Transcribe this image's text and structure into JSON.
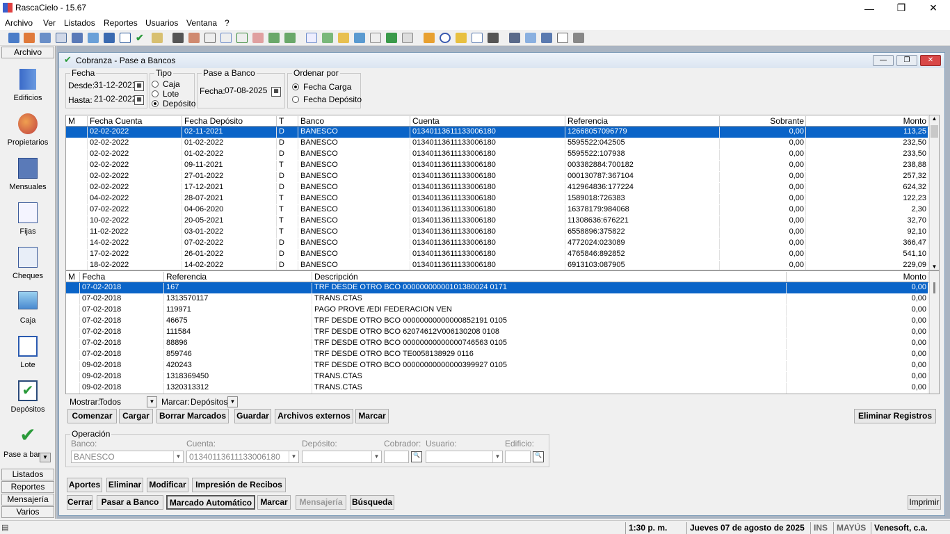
{
  "app": {
    "title": "RascaCielo - 15.67",
    "menu": [
      "Archivo",
      "Ver",
      "Listados",
      "Reportes",
      "Usuarios",
      "Ventana",
      "?"
    ]
  },
  "sidebar": {
    "header": "Archivo",
    "items": [
      "Edificios",
      "Propietarios",
      "Mensuales",
      "Fijas",
      "Cheques",
      "Caja",
      "Lote",
      "Depósitos",
      "Pase a bar"
    ],
    "bottom": [
      "Listados",
      "Reportes",
      "Mensajería",
      "Varios"
    ]
  },
  "window": {
    "title": "Cobranza - Pase a Bancos"
  },
  "fecha": {
    "legend": "Fecha",
    "desde_label": "Desde:",
    "desde": "31-12-2021",
    "hasta_label": "Hasta:",
    "hasta": "21-02-2022"
  },
  "tipo": {
    "legend": "Tipo",
    "options": [
      "Caja",
      "Lote",
      "Depósito"
    ]
  },
  "pase": {
    "legend": "Pase a Banco",
    "label": "Fecha:",
    "value": "07-08-2025"
  },
  "orden": {
    "legend": "Ordenar por",
    "options": [
      "Fecha Carga",
      "Fecha Depósito"
    ]
  },
  "grid1": {
    "headers": [
      "M",
      "Fecha Cuenta",
      "Fecha Depósito",
      "T",
      "Banco",
      "Cuenta",
      "Referencia",
      "Sobrante",
      "Monto"
    ],
    "rows": [
      [
        "",
        "02-02-2022",
        "02-11-2021",
        "D",
        "BANESCO",
        "01340113611133006180",
        "12668057096779",
        "0,00",
        "113,25"
      ],
      [
        "",
        "02-02-2022",
        "01-02-2022",
        "D",
        "BANESCO",
        "01340113611133006180",
        "5595522:042505",
        "0,00",
        "232,50"
      ],
      [
        "",
        "02-02-2022",
        "01-02-2022",
        "D",
        "BANESCO",
        "01340113611133006180",
        "5595522:107938",
        "0,00",
        "233,50"
      ],
      [
        "",
        "02-02-2022",
        "09-11-2021",
        "T",
        "BANESCO",
        "01340113611133006180",
        "003382884:700182",
        "0,00",
        "238,88"
      ],
      [
        "",
        "02-02-2022",
        "27-01-2022",
        "D",
        "BANESCO",
        "01340113611133006180",
        "000130787:367104",
        "0,00",
        "257,32"
      ],
      [
        "",
        "02-02-2022",
        "17-12-2021",
        "D",
        "BANESCO",
        "01340113611133006180",
        "412964836:177224",
        "0,00",
        "624,32"
      ],
      [
        "",
        "04-02-2022",
        "28-07-2021",
        "T",
        "BANESCO",
        "01340113611133006180",
        "1589018:726383",
        "0,00",
        "122,23"
      ],
      [
        "",
        "07-02-2022",
        "04-06-2020",
        "T",
        "BANESCO",
        "01340113611133006180",
        "16378179:984068",
        "0,00",
        "2,30"
      ],
      [
        "",
        "10-02-2022",
        "20-05-2021",
        "T",
        "BANESCO",
        "01340113611133006180",
        "11308636:676221",
        "0,00",
        "32,70"
      ],
      [
        "",
        "11-02-2022",
        "03-01-2022",
        "T",
        "BANESCO",
        "01340113611133006180",
        "6558896:375822",
        "0,00",
        "92,10"
      ],
      [
        "",
        "14-02-2022",
        "07-02-2022",
        "D",
        "BANESCO",
        "01340113611133006180",
        "4772024:023089",
        "0,00",
        "366,47"
      ],
      [
        "",
        "17-02-2022",
        "26-01-2022",
        "D",
        "BANESCO",
        "01340113611133006180",
        "4765846:892852",
        "0,00",
        "541,10"
      ],
      [
        "",
        "18-02-2022",
        "14-02-2022",
        "D",
        "BANESCO",
        "01340113611133006180",
        "6913103:087905",
        "0,00",
        "229,09"
      ]
    ]
  },
  "grid2": {
    "headers": [
      "M",
      "Fecha",
      "Referencia",
      "Descripción",
      "Monto"
    ],
    "rows": [
      [
        "",
        "07-02-2018",
        "167",
        "TRF DESDE OTRO BCO 00000000000101380024 0171",
        "0,00"
      ],
      [
        "",
        "07-02-2018",
        "1313570117",
        "TRANS.CTAS",
        "0,00"
      ],
      [
        "",
        "07-02-2018",
        "119971",
        "PAGO PROVE /EDI FEDERACION VEN",
        "0,00"
      ],
      [
        "",
        "07-02-2018",
        "46675",
        "TRF DESDE OTRO BCO 00000000000000852191 0105",
        "0,00"
      ],
      [
        "",
        "07-02-2018",
        "111584",
        "TRF DESDE OTRO BCO 62074612V006130208 0108",
        "0,00"
      ],
      [
        "",
        "07-02-2018",
        "88896",
        "TRF DESDE OTRO BCO 00000000000000746563 0105",
        "0,00"
      ],
      [
        "",
        "07-02-2018",
        "859746",
        "TRF DESDE OTRO BCO TE0058138929 0116",
        "0,00"
      ],
      [
        "",
        "09-02-2018",
        "420243",
        "TRF DESDE OTRO BCO 00000000000000399927 0105",
        "0,00"
      ],
      [
        "",
        "09-02-2018",
        "1318369450",
        "TRANS.CTAS",
        "0,00"
      ],
      [
        "",
        "09-02-2018",
        "1320313312",
        "TRANS.CTAS",
        "0,00"
      ]
    ]
  },
  "filters": {
    "mostrar_label": "Mostrar:",
    "mostrar": "Todos",
    "marcar_label": "Marcar:",
    "marcar": "Depósitos"
  },
  "buttons1": [
    "Comenzar",
    "Cargar",
    "Borrar Marcados",
    "Guardar",
    "Archivos externos",
    "Marcar"
  ],
  "eliminar_registros": "Eliminar Registros",
  "operacion": {
    "legend": "Operación",
    "banco_label": "Banco:",
    "banco": "BANESCO",
    "cuenta_label": "Cuenta:",
    "cuenta": "01340113611133006180",
    "deposito_label": "Depósito:",
    "cobrador_label": "Cobrador:",
    "usuario_label": "Usuario:",
    "edificio_label": "Edificio:"
  },
  "buttons2": [
    "Aportes",
    "Eliminar",
    "Modificar",
    "Impresión de Recibos"
  ],
  "buttons3": [
    "Cerrar",
    "Pasar a Banco",
    "Marcado Automático",
    "Marcar",
    "Mensajería",
    "Búsqueda"
  ],
  "imprimir": "Imprimir",
  "status": {
    "time": "1:30 p. m.",
    "date": "Jueves 07 de agosto de 2025",
    "ins": "INS",
    "caps": "MAYÚS",
    "company": "Venesoft, c.a."
  },
  "colors": {
    "selection": "#0a64c8",
    "desktop": "#a9b4c2"
  }
}
